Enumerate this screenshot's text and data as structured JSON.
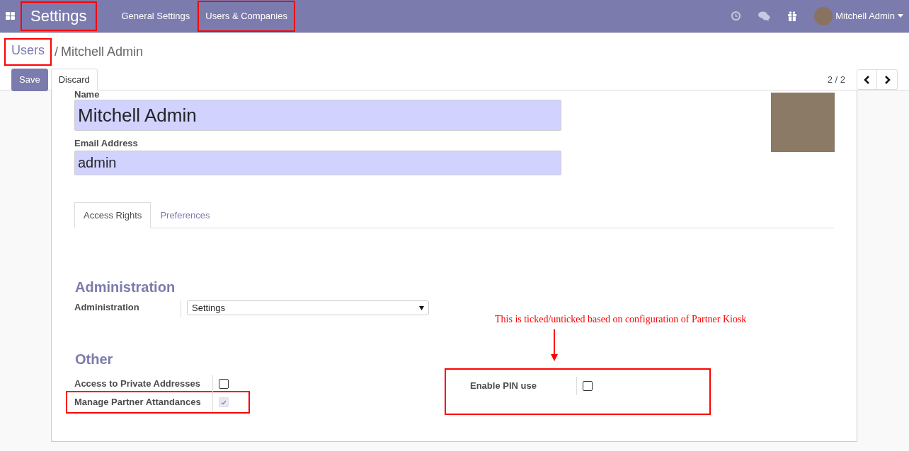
{
  "navbar": {
    "app_title": "Settings",
    "app_title_highlighted": true,
    "menu": [
      {
        "label": "General Settings",
        "highlighted": false
      },
      {
        "label": "Users & Companies",
        "highlighted": true
      }
    ],
    "user": "Mitchell Admin"
  },
  "breadcrumb": {
    "separator": "/",
    "items": [
      {
        "label": "Users",
        "kind": "link",
        "highlighted": true
      },
      {
        "label": "Mitchell Admin",
        "kind": "current",
        "highlighted": false
      }
    ]
  },
  "buttons": [
    {
      "label": "Save",
      "kind": "primary"
    },
    {
      "label": "Discard",
      "kind": "secondary"
    }
  ],
  "pager": "2 / 2",
  "form": {
    "name_label": "Name",
    "name": "Mitchell Admin",
    "email_label": "Email Address",
    "email": "admin",
    "tabs": [
      {
        "label": "Access Rights",
        "selected": true
      },
      {
        "label": "Preferences",
        "selected": false
      }
    ],
    "administration": {
      "title": "Administration",
      "label": "Administration",
      "value": "Settings"
    },
    "other": {
      "title": "Other",
      "left": [
        {
          "label": "Access to Private Addresses",
          "checked": false,
          "readonly": false
        },
        {
          "label": "Manage Partner Attandances",
          "checked": true,
          "readonly": true
        }
      ],
      "right": [
        {
          "label": "Enable PIN use",
          "checked": false,
          "readonly": false
        }
      ],
      "manage_highlighted": true,
      "right_highlighted": true
    }
  },
  "annotation": {
    "text": "This is ticked/unticked based on configuration of Partner Kiosk"
  }
}
